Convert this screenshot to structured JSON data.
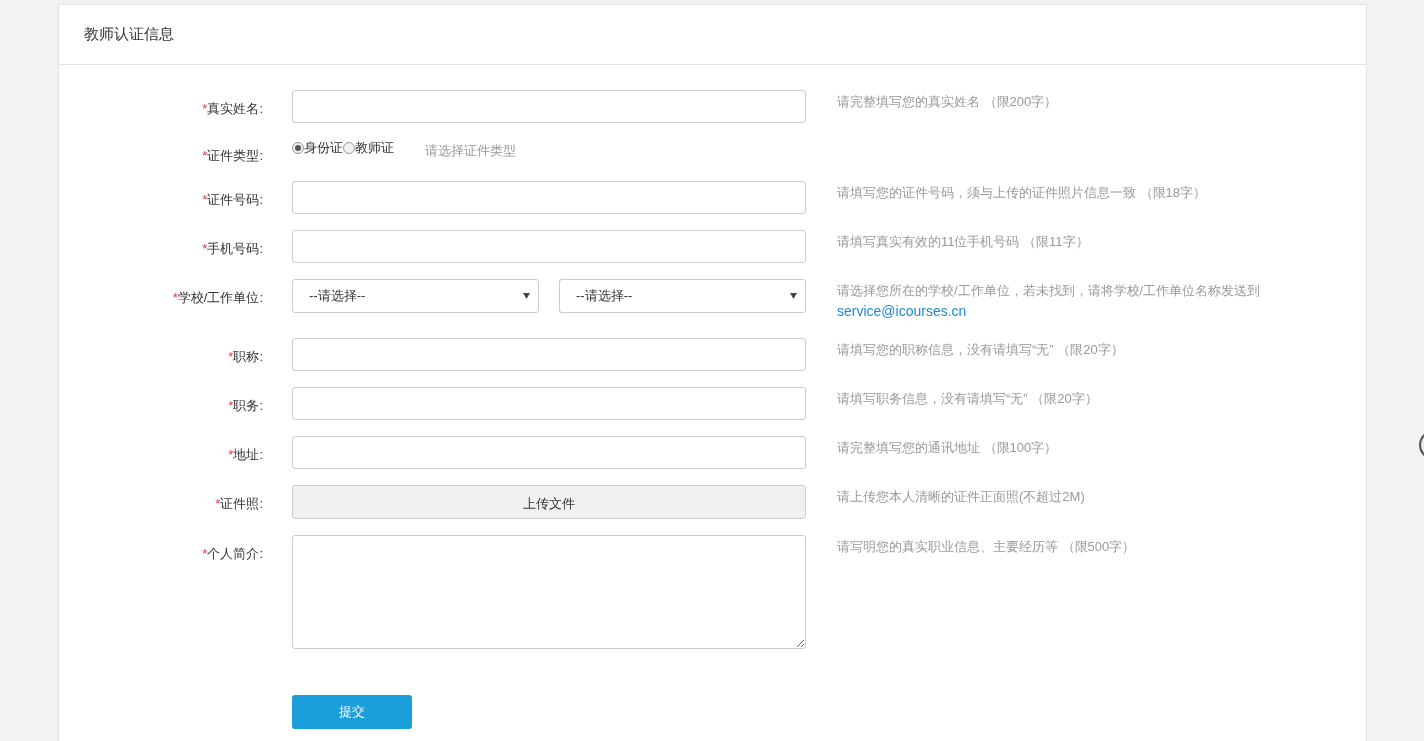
{
  "card": {
    "title": "教师认证信息"
  },
  "form": {
    "rows": [
      {
        "kind": "input",
        "mark": "*",
        "label": "真实姓名:",
        "hint": "请完整填写您的真实姓名 （限200字）"
      },
      {
        "kind": "radio",
        "mark": "*",
        "label": "证件类型:",
        "options": [
          {
            "label": "身份证",
            "selected": true
          },
          {
            "label": "教师证",
            "selected": false
          }
        ],
        "hint": "请选择证件类型"
      },
      {
        "kind": "input",
        "mark": "*",
        "label": "证件号码:",
        "hint": "请填写您的证件号码，须与上传的证件照片信息一致 （限18字）"
      },
      {
        "kind": "input",
        "mark": "*",
        "label": "手机号码:",
        "hint": "请填写真实有效的11位手机号码 （限11字）"
      },
      {
        "kind": "select",
        "mark": "*",
        "label": "学校/工作单位:",
        "selects": [
          "--请选择--",
          "--请选择--"
        ],
        "hint": "请选择您所在的学校/工作单位，若未找到，请将学校/工作单位名称发送到",
        "hint_link": "service@icourses.cn"
      },
      {
        "kind": "input",
        "mark": "*",
        "label": "职称:",
        "hint": "请填写您的职称信息，没有请填写“无” （限20字）"
      },
      {
        "kind": "input",
        "mark": "*",
        "label": "职务:",
        "hint": "请填写职务信息，没有请填写“无” （限20字）"
      },
      {
        "kind": "input",
        "mark": "*",
        "label": "地址:",
        "hint": "请完整填写您的通讯地址 （限100字）"
      },
      {
        "kind": "upload",
        "mark": "*",
        "label": "证件照:",
        "button": "上传文件",
        "hint": "请上传您本人清晰的证件正面照(不超过2M)"
      },
      {
        "kind": "textarea",
        "mark": "*",
        "label": "个人简介:",
        "hint": "请写明您的真实职业信息、主要经历等 （限500字）"
      }
    ],
    "submit": "提交"
  }
}
